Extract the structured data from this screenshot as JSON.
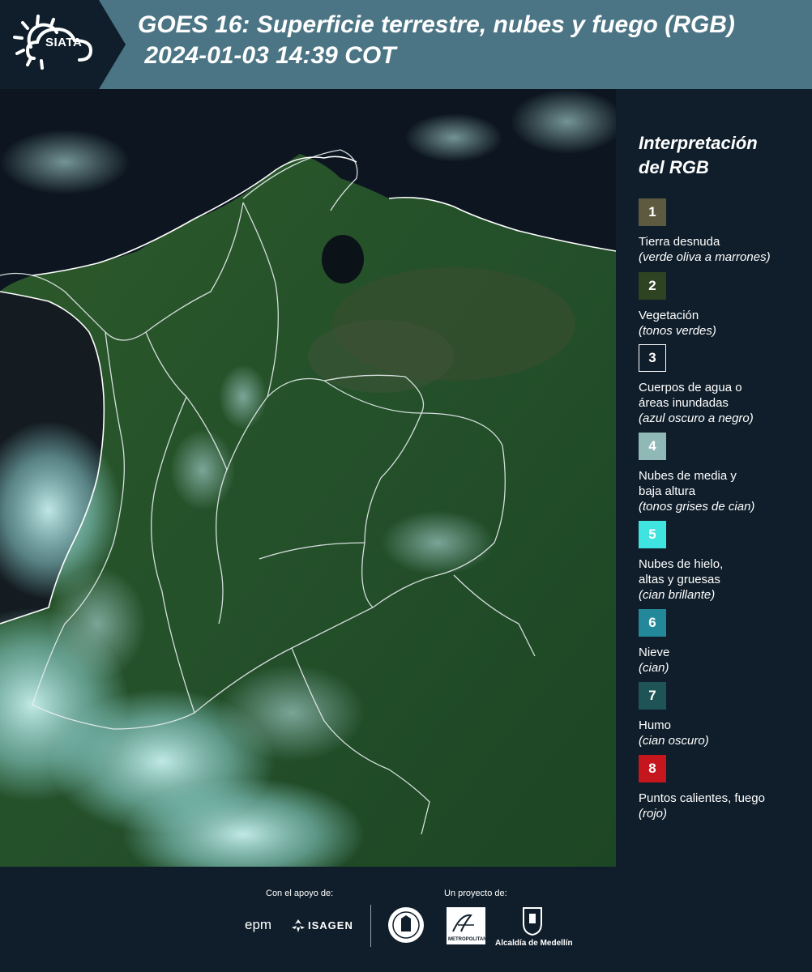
{
  "header": {
    "logo_text": "SIATA",
    "title_line1": "GOES 16: Superficie terrestre, nubes y fuego (RGB)",
    "title_line2": " 2024-01-03 14:39 COT"
  },
  "legend": {
    "title_line1": "Interpretación",
    "title_line2": "del RGB",
    "items": [
      {
        "number": "1",
        "color": "#5e5a40",
        "label_lines": [
          "Tierra desnuda"
        ],
        "note": "(verde oliva a marrones)"
      },
      {
        "number": "2",
        "color": "#2e4321",
        "label_lines": [
          "Vegetación"
        ],
        "note": "(tonos verdes)"
      },
      {
        "number": "3",
        "color": "#0f1e2a",
        "label_lines": [
          "Cuerpos de agua o",
          "áreas inundadas"
        ],
        "note": "(azul oscuro a negro)"
      },
      {
        "number": "4",
        "color": "#8fb8b6",
        "label_lines": [
          "Nubes de media y",
          "baja altura"
        ],
        "note": "(tonos grises de cian)"
      },
      {
        "number": "5",
        "color": "#3fe3e0",
        "label_lines": [
          "Nubes de hielo,",
          "altas y gruesas"
        ],
        "note": "(cian brillante)"
      },
      {
        "number": "6",
        "color": "#23899a",
        "label_lines": [
          "Nieve"
        ],
        "note": "(cian)"
      },
      {
        "number": "7",
        "color": "#1e5455",
        "label_lines": [
          "Humo"
        ],
        "note": "(cian oscuro)"
      },
      {
        "number": "8",
        "color": "#c4161c",
        "label_lines": [
          "Puntos calientes, fuego"
        ],
        "note": "(rojo)"
      }
    ]
  },
  "footer": {
    "support_label": "Con el apoyo de:",
    "project_label": "Un proyecto de:",
    "sponsors": [
      "epm",
      "ISAGEN"
    ],
    "partners": [
      "METROPOLITANA",
      "Alcaldía de Medellín"
    ]
  }
}
